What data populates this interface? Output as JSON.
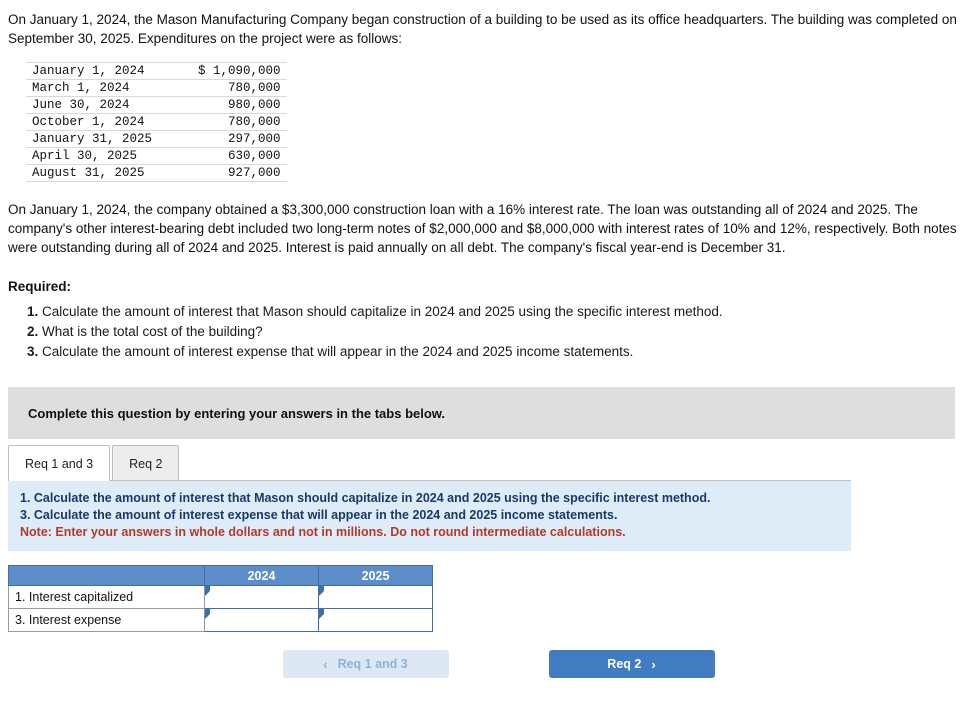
{
  "problem": {
    "paragraph_1": "On January 1, 2024, the Mason Manufacturing Company began construction of a building to be used as its office headquarters. The building was completed on September 30, 2025. Expenditures on the project were as follows:",
    "paragraph_2": "On January 1, 2024, the company obtained a $3,300,000 construction loan with a 16% interest rate. The loan was outstanding all of 2024 and 2025. The company's other interest-bearing debt included two long-term notes of $2,000,000 and $8,000,000 with interest rates of 10% and 12%, respectively. Both notes were outstanding during all of 2024 and 2025. Interest is paid annually on all debt. The company's fiscal year-end is December 31."
  },
  "expenditures": {
    "rows": [
      {
        "date": "January 1, 2024",
        "amount": "$ 1,090,000"
      },
      {
        "date": "March 1, 2024",
        "amount": "780,000"
      },
      {
        "date": "June 30, 2024",
        "amount": "980,000"
      },
      {
        "date": "October 1, 2024",
        "amount": "780,000"
      },
      {
        "date": "January 31, 2025",
        "amount": "297,000"
      },
      {
        "date": "April 30, 2025",
        "amount": "630,000"
      },
      {
        "date": "August 31, 2025",
        "amount": "927,000"
      }
    ]
  },
  "required": {
    "heading": "Required:",
    "items": [
      "Calculate the amount of interest that Mason should capitalize in 2024 and 2025 using the specific interest method.",
      "What is the total cost of the building?",
      "Calculate the amount of interest expense that will appear in the 2024 and 2025 income statements."
    ]
  },
  "banner": {
    "text": "Complete this question by entering your answers in the tabs below."
  },
  "tabs": [
    {
      "label": "Req 1 and 3",
      "active": true
    },
    {
      "label": "Req 2",
      "active": false
    }
  ],
  "instructions": {
    "line_1": "1. Calculate the amount of interest that Mason should capitalize in 2024 and 2025 using the specific interest method.",
    "line_2": "3. Calculate the amount of interest expense that will appear in the 2024 and 2025 income statements.",
    "note": "Note: Enter your answers in whole dollars and not in millions. Do not round intermediate calculations."
  },
  "answer_table": {
    "headers": [
      "",
      "2024",
      "2025"
    ],
    "rows": [
      {
        "label": "1. Interest capitalized",
        "y2024": "",
        "y2025": ""
      },
      {
        "label": "3. Interest expense",
        "y2024": "",
        "y2025": ""
      }
    ]
  },
  "nav": {
    "prev_label": "Req 1 and 3",
    "next_label": "Req 2",
    "prev_chevron": "‹",
    "next_chevron": "›"
  }
}
